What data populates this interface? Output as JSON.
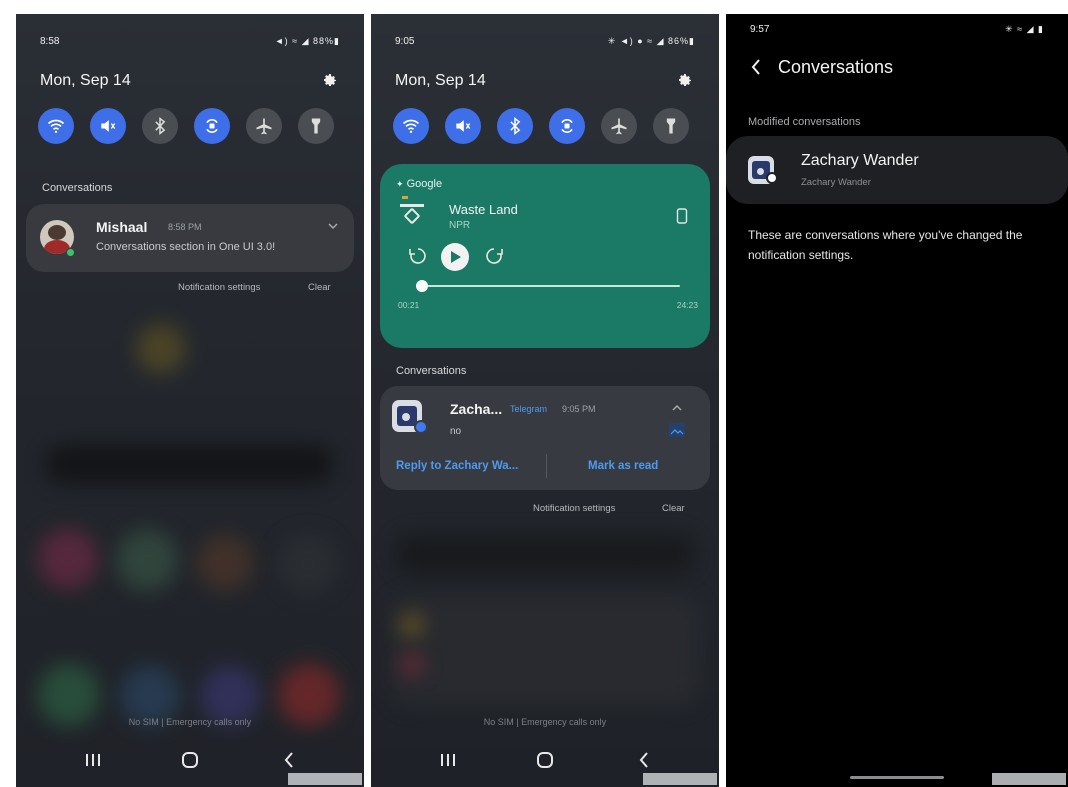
{
  "screen1": {
    "status_time": "8:58",
    "status_icons": "◄) ≈ ◢ 88%▮",
    "date": "Mon, Sep 14",
    "conversations_label": "Conversations",
    "notification": {
      "sender": "Mishaal",
      "time": "8:58 PM",
      "text": "Conversations section in One UI 3.0!"
    },
    "notification_settings": "Notification settings",
    "clear": "Clear",
    "sim_status": "No SIM | Emergency calls only"
  },
  "screen2": {
    "status_time": "9:05",
    "status_icons": "✳ ◄) ● ≈ ◢ 86%▮",
    "date": "Mon, Sep 14",
    "media": {
      "source": "Google",
      "title": "Waste Land",
      "artist": "NPR",
      "elapsed": "00:21",
      "total": "24:23",
      "progress": 0.015
    },
    "conversations_label": "Conversations",
    "notification": {
      "sender": "Zacha...",
      "app": "Telegram",
      "time": "9:05 PM",
      "text": "no",
      "reply_action": "Reply to Zachary Wa...",
      "read_action": "Mark as read"
    },
    "notification_settings": "Notification settings",
    "clear": "Clear",
    "sim_status": "No SIM | Emergency calls only"
  },
  "screen3": {
    "status_time": "9:57",
    "status_icons": "✳ ≈ ◢ ▮",
    "page_title": "Conversations",
    "section": "Modified conversations",
    "contact_name": "Zachary Wander",
    "contact_sub": "Zachary Wander",
    "description": "These are conversations where you've changed the notification settings."
  },
  "colors": {
    "accent_blue": "#3e6ee8",
    "media_green": "#1a7a66",
    "link_blue": "#4d9bf0"
  }
}
